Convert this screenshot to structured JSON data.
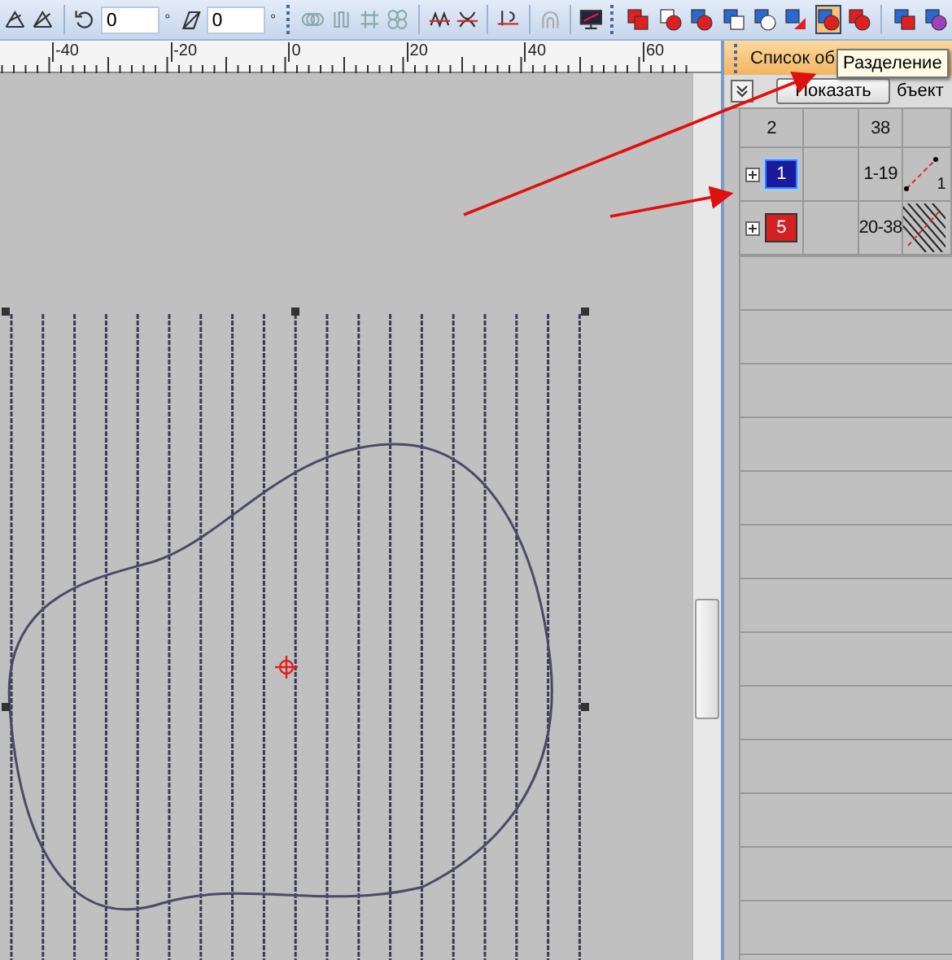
{
  "toolbar": {
    "rotate": {
      "value": "0",
      "unit": "°"
    },
    "slant": {
      "value": "0",
      "unit": "°"
    },
    "shape_tools": [
      {
        "selected": false
      },
      {
        "selected": false
      },
      {
        "selected": false
      },
      {
        "selected": false
      },
      {
        "selected": false
      },
      {
        "selected": false
      },
      {
        "selected": true
      },
      {
        "selected": false
      },
      {
        "selected": false
      },
      {
        "selected": false
      }
    ]
  },
  "ruler": {
    "labels": [
      "-40",
      "-20",
      "0",
      "20",
      "40",
      "60"
    ]
  },
  "tooltip": "Разделение",
  "panel": {
    "title": "Список об",
    "show_button": "Показать",
    "column_label": "бъект",
    "columns": [
      "2",
      "",
      "38",
      ""
    ],
    "rows": [
      {
        "number": "1",
        "color": "#1a1a9c",
        "selected": true,
        "range": "1-19",
        "kind": "line",
        "stitch_label": "1"
      },
      {
        "number": "5",
        "color": "#d42020",
        "selected": false,
        "range": "20-38",
        "kind": "hatch"
      }
    ]
  }
}
